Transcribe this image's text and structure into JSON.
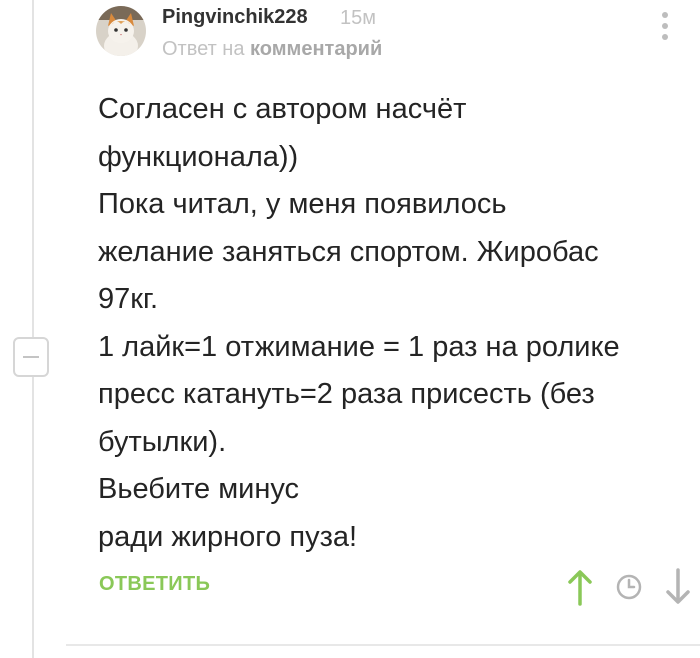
{
  "comment": {
    "username": "Pingvinchik228",
    "time": "15м",
    "reply_prefix": "Ответ на",
    "reply_target": "комментарий",
    "text_lines": [
      "Согласен с автором насчёт",
      "функционала))",
      "Пока читал, у меня появилось",
      "желание заняться спортом. Жиробас",
      "97кг.",
      "1 лайк=1 отжимание = 1 раз на ролике",
      "пресс катануть=2 раза присесть (без",
      "бутылки).",
      "Вьебите минус",
      "ради жирного пуза!"
    ],
    "reply_button": "ОТВЕТИТЬ"
  },
  "icons": {
    "avatar": "cat-avatar",
    "more": "more-vertical-icon",
    "collapse": "collapse-minus-icon",
    "vote_up": "arrow-up-icon",
    "save": "clock-icon",
    "vote_down": "arrow-down-icon"
  },
  "colors": {
    "accent_green": "#8ac858",
    "muted_text": "#c2c2c2",
    "body_text": "#242424"
  }
}
